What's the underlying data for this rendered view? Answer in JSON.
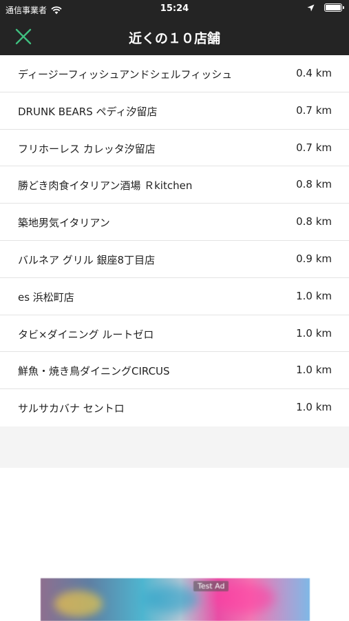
{
  "status_bar": {
    "carrier": "通信事業者",
    "time": "15:24"
  },
  "header": {
    "title": "近くの１０店舗",
    "close_icon": "close-icon",
    "accent_color": "#3fbf7f"
  },
  "stores": [
    {
      "name": "ディージーフィッシュアンドシェルフィッシュ",
      "distance": "0.4 km"
    },
    {
      "name": "DRUNK BEARS ペディ汐留店",
      "distance": "0.7 km"
    },
    {
      "name": "フリホーレス カレッタ汐留店",
      "distance": "0.7 km"
    },
    {
      "name": "勝どき肉食イタリアン酒場 Ｒkitchen",
      "distance": "0.8 km"
    },
    {
      "name": "築地男気イタリアン",
      "distance": "0.8 km"
    },
    {
      "name": "バルネア グリル 銀座8丁目店",
      "distance": "0.9 km"
    },
    {
      "name": "es 浜松町店",
      "distance": "1.0 km"
    },
    {
      "name": "タビ×ダイニング ルートゼロ",
      "distance": "1.0 km"
    },
    {
      "name": "鮮魚・焼き鳥ダイニングCIRCUS",
      "distance": "1.0 km"
    },
    {
      "name": "サルサカバナ セントロ",
      "distance": "1.0 km"
    }
  ],
  "ad": {
    "label": "Test Ad"
  }
}
